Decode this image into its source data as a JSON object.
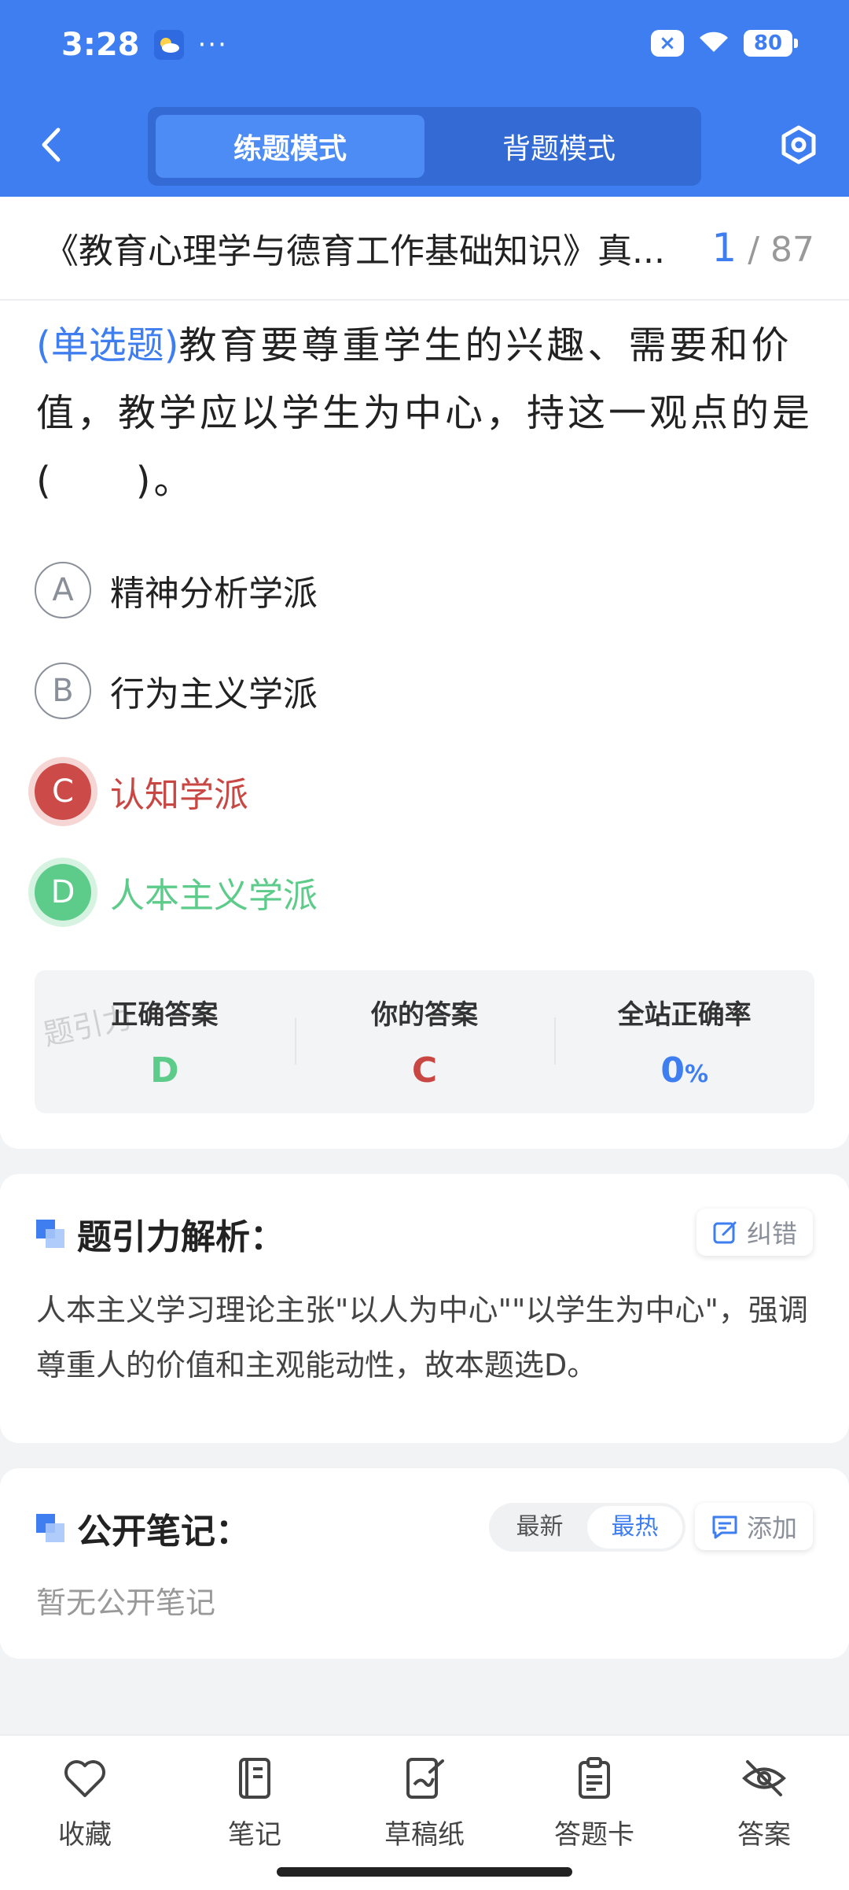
{
  "status": {
    "time": "3:28",
    "dots": "···",
    "battery": "80",
    "sim": "×"
  },
  "mode_tabs": {
    "practice": "练题模式",
    "memorize": "背题模式"
  },
  "title": {
    "book": "《教育心理学与德育工作基础知识》真...",
    "current": "1",
    "total": "/ 87"
  },
  "question": {
    "type": "(单选题)",
    "text": "教育要尊重学生的兴趣、需要和价值，教学应以学生为中心，持这一观点的是(　　)。"
  },
  "options": [
    {
      "letter": "A",
      "text": "精神分析学派"
    },
    {
      "letter": "B",
      "text": "行为主义学派"
    },
    {
      "letter": "C",
      "text": "认知学派"
    },
    {
      "letter": "D",
      "text": "人本主义学派"
    }
  ],
  "summary": {
    "correct_label": "正确答案",
    "correct_value": "D",
    "yours_label": "你的答案",
    "yours_value": "C",
    "rate_label": "全站正确率",
    "rate_value": "0",
    "rate_unit": "%"
  },
  "watermark": "题引力",
  "analysis": {
    "title": "题引力解析：",
    "report": "纠错",
    "text": "人本主义学习理论主张\"以人为中心\"\"以学生为中心\"，强调尊重人的价值和主观能动性，故本题选D。"
  },
  "notes": {
    "title": "公开笔记：",
    "sort_latest": "最新",
    "sort_hot": "最热",
    "add": "添加",
    "empty": "暂无公开笔记"
  },
  "toolbar": {
    "favorite": "收藏",
    "notes": "笔记",
    "scratch": "草稿纸",
    "answer_card": "答题卡",
    "answer": "答案"
  },
  "colors": {
    "primary": "#3e7ef0",
    "wrong": "#c94743",
    "correct": "#5dcb8a"
  }
}
